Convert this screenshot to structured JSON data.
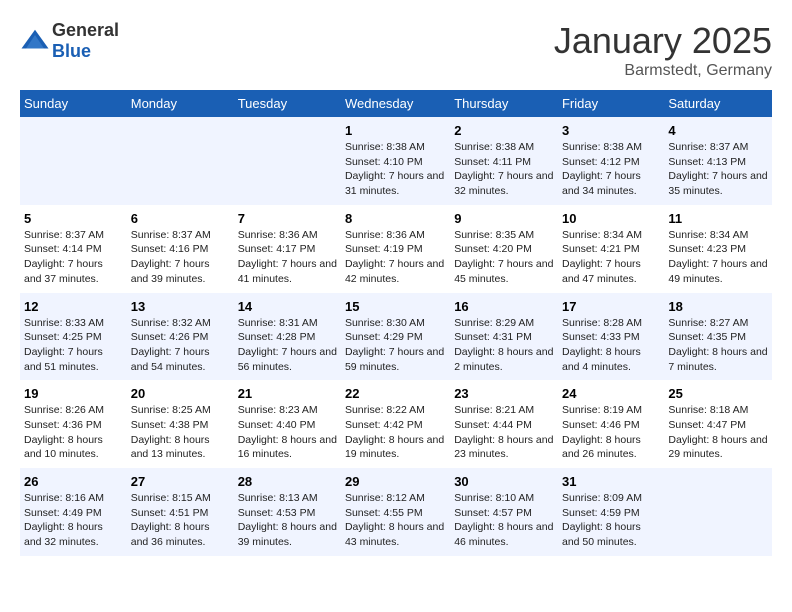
{
  "header": {
    "logo": {
      "general": "General",
      "blue": "Blue"
    },
    "title": "January 2025",
    "location": "Barmstedt, Germany"
  },
  "weekdays": [
    "Sunday",
    "Monday",
    "Tuesday",
    "Wednesday",
    "Thursday",
    "Friday",
    "Saturday"
  ],
  "weeks": [
    [
      null,
      null,
      null,
      {
        "day": "1",
        "sunrise": "8:38 AM",
        "sunset": "4:10 PM",
        "daylight": "7 hours and 31 minutes."
      },
      {
        "day": "2",
        "sunrise": "8:38 AM",
        "sunset": "4:11 PM",
        "daylight": "7 hours and 32 minutes."
      },
      {
        "day": "3",
        "sunrise": "8:38 AM",
        "sunset": "4:12 PM",
        "daylight": "7 hours and 34 minutes."
      },
      {
        "day": "4",
        "sunrise": "8:37 AM",
        "sunset": "4:13 PM",
        "daylight": "7 hours and 35 minutes."
      }
    ],
    [
      {
        "day": "5",
        "sunrise": "8:37 AM",
        "sunset": "4:14 PM",
        "daylight": "7 hours and 37 minutes."
      },
      {
        "day": "6",
        "sunrise": "8:37 AM",
        "sunset": "4:16 PM",
        "daylight": "7 hours and 39 minutes."
      },
      {
        "day": "7",
        "sunrise": "8:36 AM",
        "sunset": "4:17 PM",
        "daylight": "7 hours and 41 minutes."
      },
      {
        "day": "8",
        "sunrise": "8:36 AM",
        "sunset": "4:19 PM",
        "daylight": "7 hours and 42 minutes."
      },
      {
        "day": "9",
        "sunrise": "8:35 AM",
        "sunset": "4:20 PM",
        "daylight": "7 hours and 45 minutes."
      },
      {
        "day": "10",
        "sunrise": "8:34 AM",
        "sunset": "4:21 PM",
        "daylight": "7 hours and 47 minutes."
      },
      {
        "day": "11",
        "sunrise": "8:34 AM",
        "sunset": "4:23 PM",
        "daylight": "7 hours and 49 minutes."
      }
    ],
    [
      {
        "day": "12",
        "sunrise": "8:33 AM",
        "sunset": "4:25 PM",
        "daylight": "7 hours and 51 minutes."
      },
      {
        "day": "13",
        "sunrise": "8:32 AM",
        "sunset": "4:26 PM",
        "daylight": "7 hours and 54 minutes."
      },
      {
        "day": "14",
        "sunrise": "8:31 AM",
        "sunset": "4:28 PM",
        "daylight": "7 hours and 56 minutes."
      },
      {
        "day": "15",
        "sunrise": "8:30 AM",
        "sunset": "4:29 PM",
        "daylight": "7 hours and 59 minutes."
      },
      {
        "day": "16",
        "sunrise": "8:29 AM",
        "sunset": "4:31 PM",
        "daylight": "8 hours and 2 minutes."
      },
      {
        "day": "17",
        "sunrise": "8:28 AM",
        "sunset": "4:33 PM",
        "daylight": "8 hours and 4 minutes."
      },
      {
        "day": "18",
        "sunrise": "8:27 AM",
        "sunset": "4:35 PM",
        "daylight": "8 hours and 7 minutes."
      }
    ],
    [
      {
        "day": "19",
        "sunrise": "8:26 AM",
        "sunset": "4:36 PM",
        "daylight": "8 hours and 10 minutes."
      },
      {
        "day": "20",
        "sunrise": "8:25 AM",
        "sunset": "4:38 PM",
        "daylight": "8 hours and 13 minutes."
      },
      {
        "day": "21",
        "sunrise": "8:23 AM",
        "sunset": "4:40 PM",
        "daylight": "8 hours and 16 minutes."
      },
      {
        "day": "22",
        "sunrise": "8:22 AM",
        "sunset": "4:42 PM",
        "daylight": "8 hours and 19 minutes."
      },
      {
        "day": "23",
        "sunrise": "8:21 AM",
        "sunset": "4:44 PM",
        "daylight": "8 hours and 23 minutes."
      },
      {
        "day": "24",
        "sunrise": "8:19 AM",
        "sunset": "4:46 PM",
        "daylight": "8 hours and 26 minutes."
      },
      {
        "day": "25",
        "sunrise": "8:18 AM",
        "sunset": "4:47 PM",
        "daylight": "8 hours and 29 minutes."
      }
    ],
    [
      {
        "day": "26",
        "sunrise": "8:16 AM",
        "sunset": "4:49 PM",
        "daylight": "8 hours and 32 minutes."
      },
      {
        "day": "27",
        "sunrise": "8:15 AM",
        "sunset": "4:51 PM",
        "daylight": "8 hours and 36 minutes."
      },
      {
        "day": "28",
        "sunrise": "8:13 AM",
        "sunset": "4:53 PM",
        "daylight": "8 hours and 39 minutes."
      },
      {
        "day": "29",
        "sunrise": "8:12 AM",
        "sunset": "4:55 PM",
        "daylight": "8 hours and 43 minutes."
      },
      {
        "day": "30",
        "sunrise": "8:10 AM",
        "sunset": "4:57 PM",
        "daylight": "8 hours and 46 minutes."
      },
      {
        "day": "31",
        "sunrise": "8:09 AM",
        "sunset": "4:59 PM",
        "daylight": "8 hours and 50 minutes."
      },
      null
    ]
  ]
}
